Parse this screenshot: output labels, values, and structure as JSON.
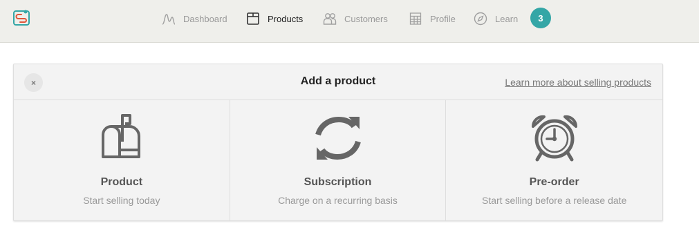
{
  "nav": {
    "items": [
      {
        "label": "Dashboard",
        "icon": "chart-peaks-icon"
      },
      {
        "label": "Products",
        "icon": "box-icon"
      },
      {
        "label": "Customers",
        "icon": "people-icon"
      },
      {
        "label": "Profile",
        "icon": "layout-grid-icon"
      },
      {
        "label": "Learn",
        "icon": "compass-icon"
      }
    ],
    "active": "Products",
    "badge_count": "3"
  },
  "panel": {
    "close_label": "×",
    "title": "Add a product",
    "learn_link": "Learn more about selling products",
    "options": [
      {
        "title": "Product",
        "subtitle": "Start selling today",
        "icon": "mailbox-icon"
      },
      {
        "title": "Subscription",
        "subtitle": "Charge on a recurring basis",
        "icon": "refresh-arrows-icon"
      },
      {
        "title": "Pre-order",
        "subtitle": "Start selling before a release date",
        "icon": "alarm-clock-icon"
      }
    ]
  },
  "colors": {
    "accent": "#34a6a6",
    "logo_teal": "#34a6a6",
    "logo_red": "#e0553a",
    "topbar_bg": "#efefeb",
    "panel_bg": "#f3f3f3",
    "icon_gray": "#666666"
  }
}
